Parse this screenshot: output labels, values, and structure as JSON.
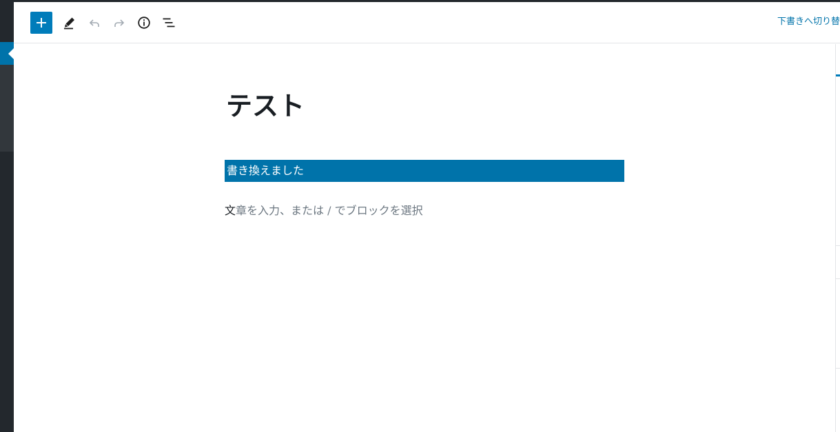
{
  "toolbar": {
    "inserter_icon": "plus-icon",
    "tools_icon": "pencil-icon",
    "undo_icon": "undo-icon",
    "redo_icon": "redo-icon",
    "info_icon": "info-icon",
    "outline_icon": "block-navigation-icon",
    "save_draft_label": "下書きへ切り替"
  },
  "post": {
    "title": "テスト",
    "selected_paragraph": "書き換えました",
    "placeholder_first_char": "文",
    "placeholder_rest": "章を入力、または / でブロックを選択"
  },
  "colors": {
    "accent": "#007cba",
    "selection": "#0073aa",
    "admin_sidebar": "#23282d"
  }
}
